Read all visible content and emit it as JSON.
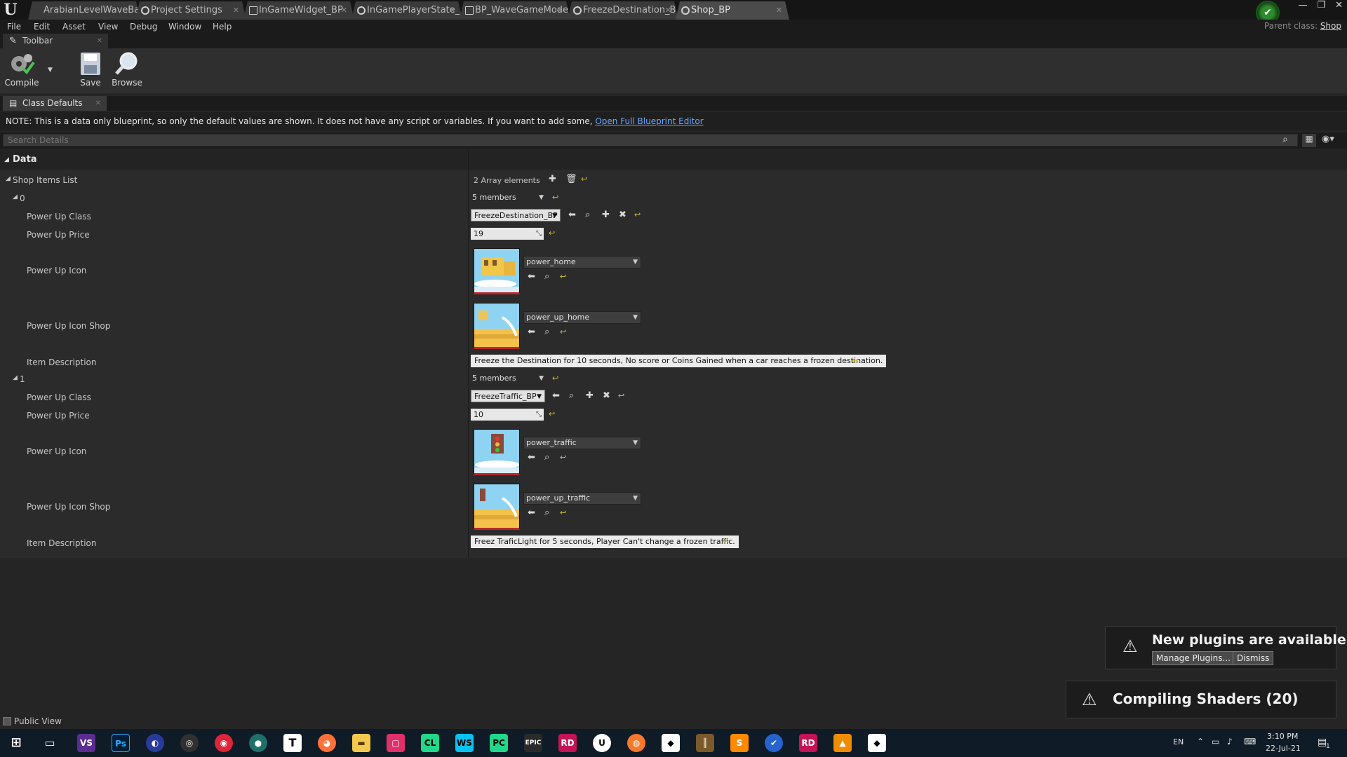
{
  "tabs": [
    {
      "label": "ArabianLevelWaveBased",
      "active": false
    },
    {
      "label": "Project Settings",
      "active": false
    },
    {
      "label": "InGameWidget_BP",
      "active": false
    },
    {
      "label": "InGamePlayerState_BP",
      "active": false
    },
    {
      "label": "BP_WaveGameMode",
      "active": false
    },
    {
      "label": "FreezeDestination_BP",
      "active": false
    },
    {
      "label": "Shop_BP",
      "active": true
    }
  ],
  "menu": [
    "File",
    "Edit",
    "Asset",
    "View",
    "Debug",
    "Window",
    "Help"
  ],
  "parent_class": {
    "label": "Parent class:",
    "value": "Shop"
  },
  "toolbar": {
    "tab_label": "Toolbar",
    "compile": "Compile",
    "save": "Save",
    "browse": "Browse"
  },
  "class_defaults": {
    "tab_label": "Class Defaults",
    "note": "NOTE: This is a data only blueprint, so only the default values are shown.  It does not have any script or variables.  If you want to add some, ",
    "note_link": "Open Full Blueprint Editor",
    "search_placeholder": "Search Details"
  },
  "details": {
    "category": "Data",
    "list_label": "Shop Items List",
    "array_count": "2 Array elements",
    "members_label": "5 members",
    "field_labels": {
      "class": "Power Up Class",
      "price": "Power Up Price",
      "icon": "Power Up Icon",
      "icon_shop": "Power Up Icon Shop",
      "description": "Item Description"
    },
    "items": [
      {
        "index": "0",
        "class_value": "FreezeDestination_BP",
        "price": "19",
        "icon": "power_home",
        "icon_shop": "power_up_home",
        "description": "Freeze the Destination for 10 seconds, No score or Coins Gained when a car reaches a frozen destination."
      },
      {
        "index": "1",
        "class_value": "FreezeTraffic_BP",
        "price": "10",
        "icon": "power_traffic",
        "icon_shop": "power_up_traffic",
        "description": "Freez TraficLight for 5 seconds, Player Can't change a frozen traffic."
      }
    ]
  },
  "public_view": "Public View",
  "toasts": {
    "plugins_title": "New plugins are available",
    "manage": "Manage Plugins...",
    "dismiss": "Dismiss",
    "shaders": "Compiling Shaders (20)"
  },
  "tray": {
    "lang": "EN",
    "time": "3:10 PM",
    "date": "22-Jul-21",
    "notif_count": "1"
  },
  "taskbar_icons": [
    "windows-start",
    "task-view",
    "visual-studio",
    "photoshop",
    "app-blue",
    "obs",
    "app-red",
    "app-teal",
    "typora",
    "firefox",
    "file-explorer",
    "app-pink",
    "clion",
    "webstorm",
    "pycharm",
    "epic-games",
    "rider",
    "unreal-engine",
    "blender",
    "unity",
    "library",
    "sublime",
    "todo",
    "rider-2",
    "vlc",
    "unity-2"
  ],
  "colors": {
    "accent_link": "#6aa8ff",
    "reset_arrow": "#d4c23a",
    "thumb_border": "#b8282b"
  }
}
